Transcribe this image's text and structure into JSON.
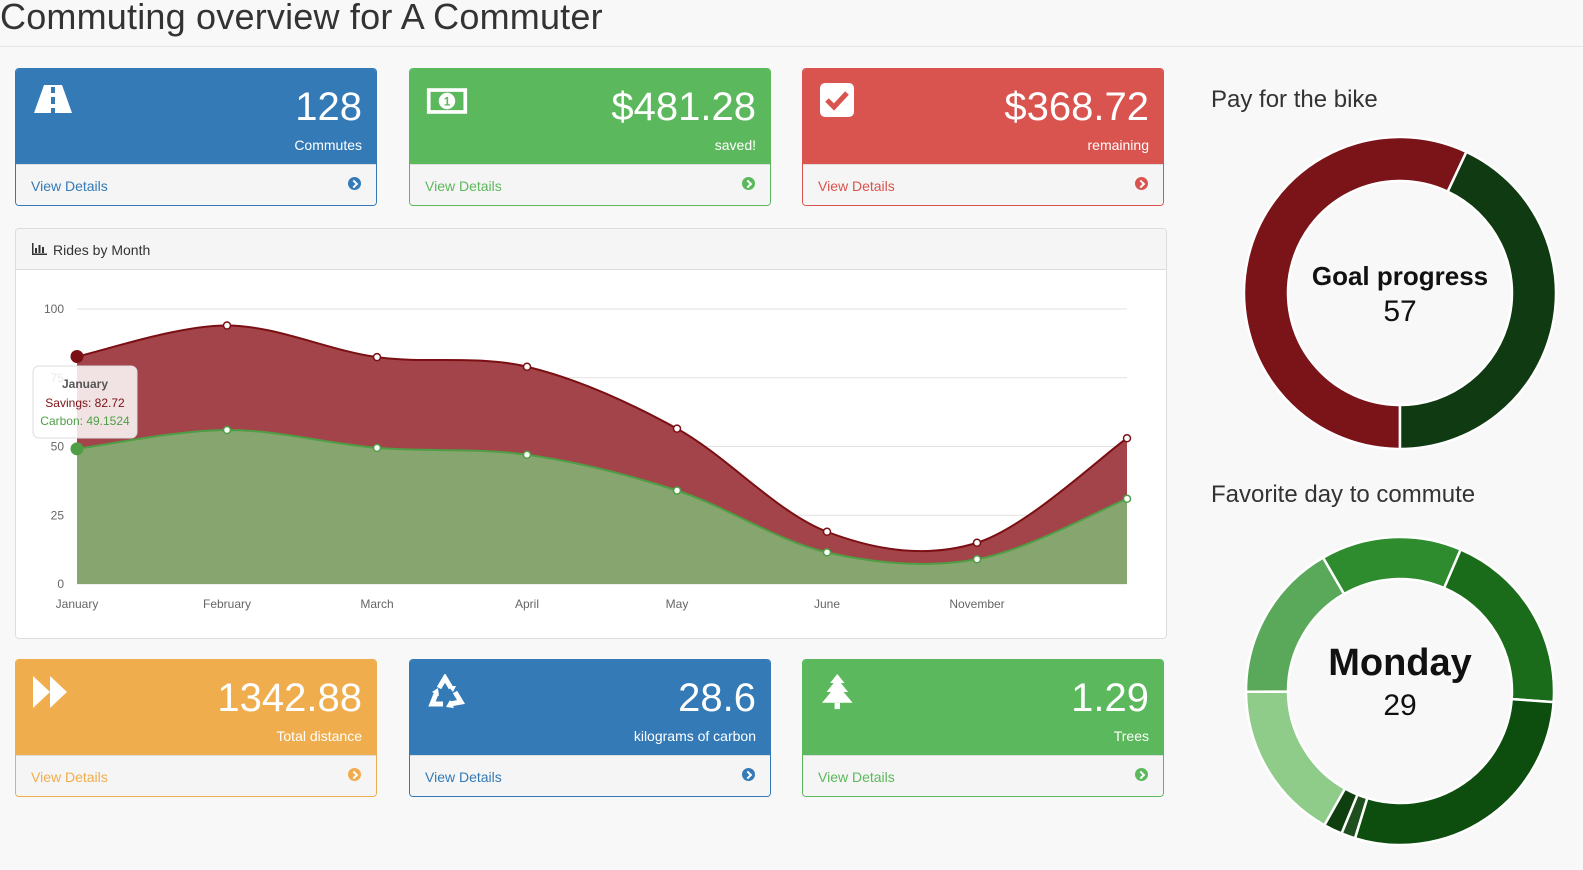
{
  "page": {
    "title": "Commuting overview for A Commuter"
  },
  "panels": [
    {
      "key": "commutes",
      "value": "128",
      "label": "Commutes",
      "link": "View Details",
      "icon": "road-icon",
      "color": "#337ab7"
    },
    {
      "key": "saved",
      "value": "$481.28",
      "label": "saved!",
      "link": "View Details",
      "icon": "money-icon",
      "color": "#5cb85c"
    },
    {
      "key": "remaining",
      "value": "$368.72",
      "label": "remaining",
      "link": "View Details",
      "icon": "check-square-icon",
      "color": "#d9534f"
    },
    {
      "key": "distance",
      "value": "1342.88",
      "label": "Total distance",
      "link": "View Details",
      "icon": "fast-forward-icon",
      "color": "#f0ad4e"
    },
    {
      "key": "carbon",
      "value": "28.6",
      "label": "kilograms of carbon",
      "link": "View Details",
      "icon": "recycle-icon",
      "color": "#337ab7"
    },
    {
      "key": "trees",
      "value": "1.29",
      "label": "Trees",
      "link": "View Details",
      "icon": "tree-icon",
      "color": "#5cb85c"
    }
  ],
  "rides_panel": {
    "title": "Rides by Month",
    "icon": "bar-chart-icon"
  },
  "tooltip": {
    "month": "January",
    "savings_label": "Savings: 82.72",
    "carbon_label": "Carbon: 49.1524"
  },
  "chart_data": {
    "type": "area",
    "title": "Rides by Month",
    "categories": [
      "January",
      "February",
      "March",
      "April",
      "May",
      "June",
      "November"
    ],
    "x_positions": [
      0,
      1,
      2,
      3,
      4,
      5,
      6,
      7
    ],
    "series": [
      {
        "name": "Savings",
        "color": "#7b1014",
        "values": [
          82.72,
          94,
          82.5,
          79,
          56.5,
          19,
          15,
          53
        ]
      },
      {
        "name": "Carbon",
        "color": "#4f9e45",
        "values": [
          49.15,
          56,
          49.5,
          47,
          34,
          11.5,
          9,
          31
        ]
      }
    ],
    "yticks": [
      0,
      25,
      50,
      75,
      100
    ],
    "ylim": [
      0,
      100
    ],
    "grid": true
  },
  "goal": {
    "title": "Pay for the bike",
    "center_label": "Goal progress",
    "center_value": "57",
    "segments": [
      {
        "value": 57,
        "color": "#7b1418"
      },
      {
        "value": 43,
        "color": "#0f3a12"
      }
    ]
  },
  "favorite_day": {
    "title": "Favorite day to commute",
    "center_label": "Monday",
    "center_value": "29",
    "segments": [
      {
        "value": 15,
        "color": "#2e8b2e"
      },
      {
        "value": 20,
        "color": "#1a6b1a"
      },
      {
        "value": 29,
        "color": "#0d4d0d"
      },
      {
        "value": 1.5,
        "color": "#1f4f1f"
      },
      {
        "value": 2,
        "color": "#0f3f0f"
      },
      {
        "value": 17,
        "color": "#8fcc8a"
      },
      {
        "value": 17,
        "color": "#5aa95a"
      }
    ]
  }
}
